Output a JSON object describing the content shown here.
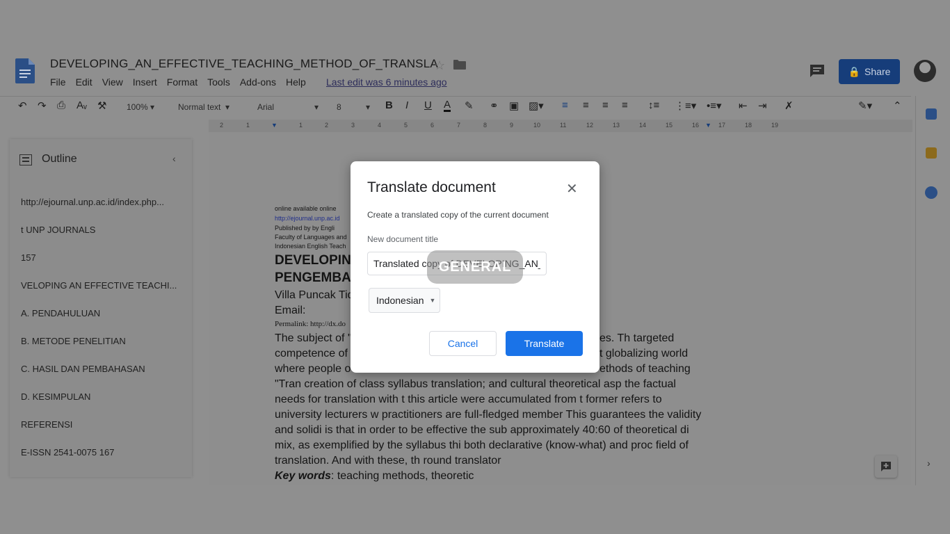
{
  "app": {
    "doc_title": "DEVELOPING_AN_EFFECTIVE_TEACHING_METHOD_OF_TRANSLA",
    "last_edit": "Last edit was 6 minutes ago",
    "share_label": "Share"
  },
  "menu": [
    "File",
    "Edit",
    "View",
    "Insert",
    "Format",
    "Tools",
    "Add-ons",
    "Help"
  ],
  "toolbar": {
    "zoom": "100%",
    "style": "Normal text",
    "font": "Arial",
    "size": "8"
  },
  "ruler": [
    "2",
    "1",
    "1",
    "2",
    "3",
    "4",
    "5",
    "6",
    "7",
    "8",
    "9",
    "10",
    "11",
    "12",
    "13",
    "14",
    "15",
    "16",
    "17",
    "18",
    "19"
  ],
  "outline": {
    "title": "Outline",
    "items": [
      "http://ejournal.unp.ac.id/index.php...",
      "t UNP JOURNALS",
      "157",
      "VELOPING AN EFFECTIVE TEACHI...",
      "A. PENDAHULUAN",
      "B. METODE PENELITIAN",
      "C. HASIL DAN PEMBAHASAN",
      "D. KESIMPULAN",
      "REFERENSI",
      "E-ISSN 2541-0075 167"
    ]
  },
  "document": {
    "small_lines": [
      "online available online",
      "http://ejournal.unp.ac.id",
      "Published by by Engli",
      "Faculty of Languages and",
      "Indonesian English Teach"
    ],
    "heading1": "DEVELOPIN",
    "heading2": "PENGEMBA",
    "author": "Villa Puncak Tid",
    "email": "Email:",
    "permalink": "Permalink: http://dx.do",
    "body": [
      "The subject of \"",
      "competence of",
      "where people o",
      "\"Tran creation of class syllabus translation; and cultural theoretical asp the factual",
      "needs for translation with t this article were accumulated from t former refers to",
      "university lecturers w practitioners are full-fledged member This guarantees the validity",
      "and solidi is that in order to be effective the sub approximately 40:60 of theoretical di",
      "mix, as exemplified by the syllabus thi both declarative (know-what) and proc field of",
      "translation. And with these, th round translator"
    ],
    "body_right": [
      "es. Th targeted",
      "t globalizing world",
      "ethods of teaching"
    ],
    "keywords_label": "Key words",
    "keywords_text": ": teaching methods, theoretic"
  },
  "dialog": {
    "title": "Translate document",
    "description": "Create a translated copy of the current document",
    "field_label": "New document title",
    "field_value": "Translated copy of DEVELOPING_AN_EFFECTIVE_TEACHING_METHOD_OF_TRANSLA",
    "language": "Indonesian",
    "cancel_label": "Cancel",
    "translate_label": "Translate"
  },
  "watermark": "GENERAL",
  "colors": {
    "primary_blue": "#1a73e8",
    "share_blue": "#163d7a",
    "overlay_gray": "#8f8f8f"
  }
}
